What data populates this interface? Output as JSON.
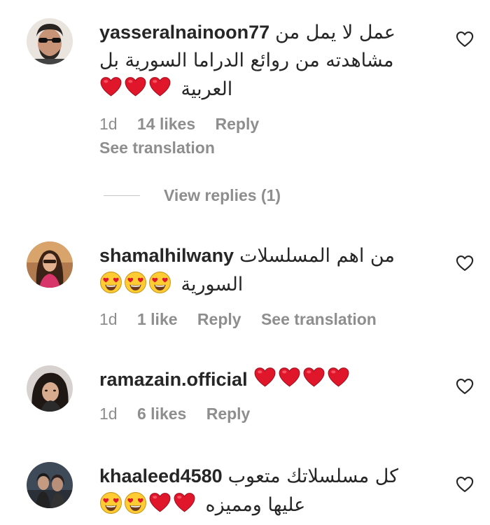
{
  "comments": [
    {
      "username": "yasseralnainoon77",
      "text_line1": "عمل لا يمل من",
      "text_line2": "مشاهدته من روائع الدراما السورية بل",
      "text_line3": "العربية",
      "emojis": [
        "red-heart",
        "red-heart",
        "red-heart"
      ],
      "time": "1d",
      "likes": "14 likes",
      "reply": "Reply",
      "see_translation": "See translation",
      "view_replies": "View replies (1)"
    },
    {
      "username": "shamalhilwany",
      "text_line1": "من اهم المسلسلات",
      "text_line2": "السورية",
      "emojis": [
        "heart-eyes",
        "heart-eyes",
        "heart-eyes"
      ],
      "time": "1d",
      "likes": "1 like",
      "reply": "Reply",
      "see_translation": "See translation"
    },
    {
      "username": "ramazain.official",
      "emojis": [
        "red-heart",
        "red-heart",
        "red-heart",
        "red-heart"
      ],
      "time": "1d",
      "likes": "6 likes",
      "reply": "Reply"
    },
    {
      "username": "khaaleed4580",
      "text_line1": "كل مسلسلاتك متعوب",
      "text_line2": "عليها ومميزه",
      "emojis": [
        "red-heart",
        "red-heart",
        "heart-eyes",
        "heart-eyes"
      ]
    }
  ],
  "colors": {
    "text": "#262626",
    "secondary": "#8e8e8e",
    "heart_red": "#e0162b",
    "emoji_yellow": "#ffcc33"
  },
  "icons": {
    "like": "heart-outline-icon",
    "red_heart": "red-heart-emoji",
    "heart_eyes": "heart-eyes-emoji"
  }
}
